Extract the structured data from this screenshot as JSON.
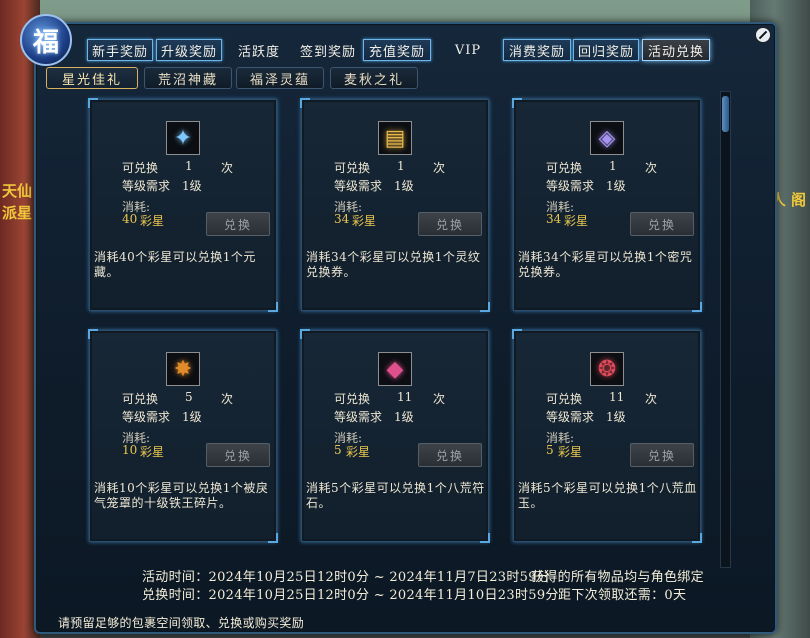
{
  "side": {
    "left_text": "天仙 派星",
    "right_text": "人 阁"
  },
  "top_tabs": [
    {
      "label": "新手奖励",
      "state": "boxed"
    },
    {
      "label": "升级奖励",
      "state": "boxed"
    },
    {
      "label": "活跃度",
      "state": "plain"
    },
    {
      "label": "签到奖励",
      "state": "plain"
    },
    {
      "label": "充值奖励",
      "state": "boxed"
    },
    {
      "label": "VIP",
      "state": "plain"
    },
    {
      "label": "消费奖励",
      "state": "boxed"
    },
    {
      "label": "回归奖励",
      "state": "boxed"
    },
    {
      "label": "活动兑换",
      "state": "active"
    }
  ],
  "sub_tabs": [
    {
      "label": "星光佳礼",
      "active": true
    },
    {
      "label": "荒沼神藏",
      "active": false
    },
    {
      "label": "福泽灵蕴",
      "active": false
    },
    {
      "label": "麦秋之礼",
      "active": false
    }
  ],
  "labels": {
    "exchangeable": "可兑换",
    "times": "次",
    "level_req": "等级需求",
    "consume": "消耗:",
    "button": "兑换",
    "unit": "彩星"
  },
  "cards": [
    {
      "icon": "blue-crystal-icon",
      "glyph": "✦",
      "color": "#7fc8ff",
      "count": "1",
      "level": "1级",
      "cost": "40",
      "desc": "消耗40个彩星可以兑换1个元藏。"
    },
    {
      "icon": "gold-scroll-icon",
      "glyph": "▤",
      "color": "#e8b84a",
      "count": "1",
      "level": "1级",
      "cost": "34",
      "desc": "消耗34个彩星可以兑换1个灵纹兑换券。"
    },
    {
      "icon": "purple-armor-icon",
      "glyph": "◈",
      "color": "#a793f0",
      "count": "1",
      "level": "1级",
      "cost": "34",
      "desc": "消耗34个彩星可以兑换1个密咒兑换券。"
    },
    {
      "icon": "iron-shard-icon",
      "glyph": "✸",
      "color": "#e08a2a",
      "count": "5",
      "level": "1级",
      "cost": "10",
      "desc": "消耗10个彩星可以兑换1个被戾气笼罩的十级铁王碎片。"
    },
    {
      "icon": "pink-rune-stone-icon",
      "glyph": "◆",
      "color": "#e0508c",
      "count": "11",
      "level": "1级",
      "cost": "5",
      "desc": "消耗5个彩星可以兑换1个八荒符石。"
    },
    {
      "icon": "red-jade-icon",
      "glyph": "❂",
      "color": "#e04a5a",
      "count": "11",
      "level": "1级",
      "cost": "5",
      "desc": "消耗5个彩星可以兑换1个八荒血玉。"
    }
  ],
  "footer": {
    "activity_time": "活动时间：2024年10月25日12时0分 ~ 2024年11月7日23时59分",
    "bind_notice": "获得的所有物品均与角色绑定",
    "exchange_time": "兑换时间：2024年10月25日12时0分 ~ 2024年11月10日23时59分",
    "next_claim": "距下次领取还需：0天",
    "reserve_notice": "请预留足够的包裹空间领取、兑换或购买奖励"
  }
}
